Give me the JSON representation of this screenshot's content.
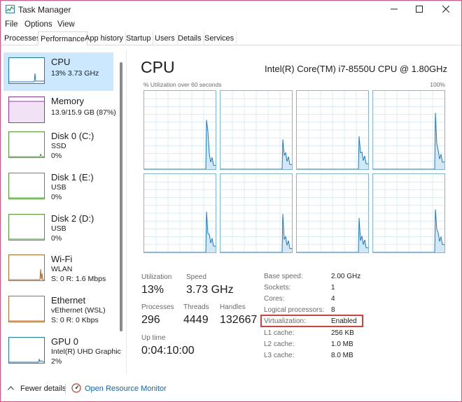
{
  "window": {
    "title": "Task Manager"
  },
  "menu": [
    "File",
    "Options",
    "View"
  ],
  "tabs": [
    "Processes",
    "Performance",
    "App history",
    "Startup",
    "Users",
    "Details",
    "Services"
  ],
  "sidebar": [
    {
      "name": "CPU",
      "sub1": "13%  3.73 GHz",
      "sub2": "",
      "color": "#1a7ac8",
      "level": 0.13
    },
    {
      "name": "Memory",
      "sub1": "13.9/15.9 GB (87%)",
      "sub2": "",
      "color": "#9b34b2",
      "level": 0.87
    },
    {
      "name": "Disk 0 (C:)",
      "sub1": "SSD",
      "sub2": "0%",
      "color": "#4aa12c",
      "level": 0
    },
    {
      "name": "Disk 1 (E:)",
      "sub1": "USB",
      "sub2": "0%",
      "color": "#4aa12c",
      "level": 0
    },
    {
      "name": "Disk 2 (D:)",
      "sub1": "USB",
      "sub2": "0%",
      "color": "#4aa12c",
      "level": 0
    },
    {
      "name": "Wi-Fi",
      "sub1": "WLAN",
      "sub2": "S: 0  R: 1.6 Mbps",
      "color": "#b8682a",
      "level": 0.3
    },
    {
      "name": "Ethernet",
      "sub1": "vEthernet (WSL)",
      "sub2": "S: 0  R: 0 Kbps",
      "color": "#b8682a",
      "level": 0
    },
    {
      "name": "GPU 0",
      "sub1": "Intel(R) UHD Graphic",
      "sub2": "2%",
      "color": "#1a7ac8",
      "level": 0.02
    }
  ],
  "main": {
    "title": "CPU",
    "model": "Intel(R) Core(TM) i7-8550U CPU @ 1.80GHz",
    "graph_label_left": "% Utilization over 60 seconds",
    "graph_label_right": "100%",
    "stats": {
      "utilization_label": "Utilization",
      "utilization_value": "13%",
      "speed_label": "Speed",
      "speed_value": "3.73 GHz",
      "processes_label": "Processes",
      "processes_value": "296",
      "threads_label": "Threads",
      "threads_value": "4449",
      "handles_label": "Handles",
      "handles_value": "132667",
      "uptime_label": "Up time",
      "uptime_value": "0:04:10:00"
    },
    "specs": [
      {
        "key": "Base speed:",
        "value": "2.00 GHz"
      },
      {
        "key": "Sockets:",
        "value": "1"
      },
      {
        "key": "Cores:",
        "value": "4"
      },
      {
        "key": "Logical processors:",
        "value": "8"
      },
      {
        "key": "Virtualization:",
        "value": "Enabled"
      },
      {
        "key": "L1 cache:",
        "value": "256 KB"
      },
      {
        "key": "L2 cache:",
        "value": "1.0 MB"
      },
      {
        "key": "L3 cache:",
        "value": "8.0 MB"
      }
    ]
  },
  "footer": {
    "fewer_details": "Fewer details",
    "resource_monitor": "Open Resource Monitor"
  },
  "colors": {
    "accent": "#1a7ac8",
    "selection": "#cce8ff",
    "highlight": "#d9403a",
    "frame": "#e04f79"
  }
}
